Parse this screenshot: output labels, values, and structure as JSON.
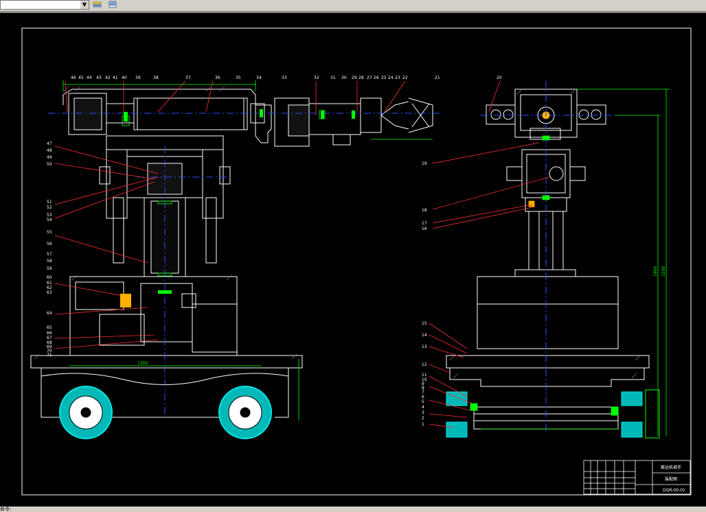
{
  "toolbar": {
    "layer_combo_value": "",
    "icons": [
      "layer-properties-icon",
      "layer-states-icon"
    ]
  },
  "statusbar": {
    "text": "命令:"
  },
  "drawing": {
    "left_top_labels": [
      "46",
      "45",
      "44",
      "43",
      "42",
      "41",
      "40",
      "39",
      "38",
      "37",
      "36",
      "35",
      "34",
      "33",
      "32",
      "31",
      "30",
      "29",
      "28",
      "27",
      "26",
      "25",
      "24",
      "23",
      "22",
      "21"
    ],
    "left_side_labels": [
      "47",
      "48",
      "49",
      "50",
      "51",
      "52",
      "53",
      "54",
      "55",
      "56",
      "57",
      "58",
      "59",
      "60",
      "61",
      "62",
      "63",
      "64",
      "65",
      "66",
      "67",
      "68",
      "69",
      "70",
      "71"
    ],
    "right_labels": [
      "20",
      "19",
      "18",
      "17",
      "16",
      "15",
      "14",
      "13",
      "12",
      "11",
      "10",
      "9",
      "8",
      "7",
      "6",
      "5",
      "4",
      "3",
      "2",
      "1"
    ],
    "dim_width": "1300",
    "dim_height_1": "1550",
    "dim_height_2": "1900"
  },
  "title_block": {
    "title": "搬运机械手",
    "subtitle": "装配图",
    "drawing_no": "DQR-00-01"
  },
  "colors": {
    "background": "#000000",
    "outline": "#ffffff",
    "dimension": "#00ff00",
    "leader": "#ff3030",
    "center": "#3050ff",
    "wheel": "#00e5e5"
  }
}
